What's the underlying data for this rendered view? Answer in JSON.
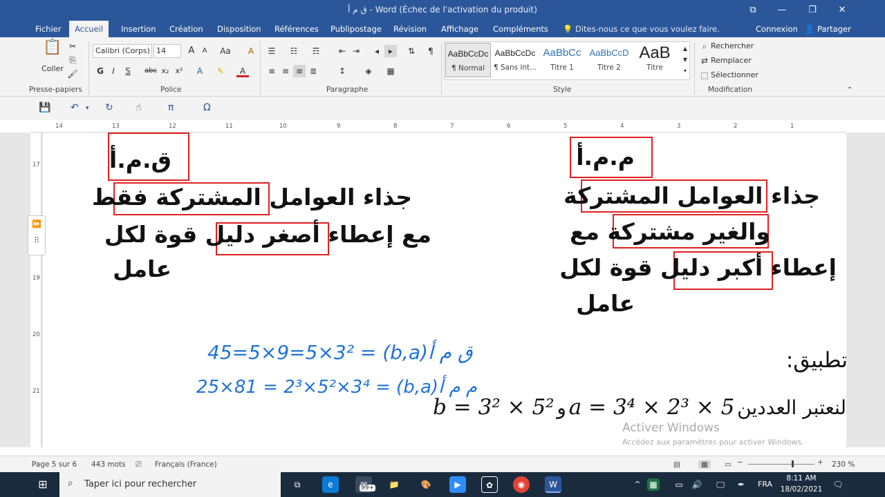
{
  "window": {
    "title": "ق م أ - Word (Échec de l'activation du produit)",
    "controls": [
      "⧉",
      "—",
      "❐",
      "✕"
    ]
  },
  "tabs": [
    "Fichier",
    "Accueil",
    "Insertion",
    "Création",
    "Disposition",
    "Références",
    "Publipostage",
    "Révision",
    "Affichage",
    "Compléments"
  ],
  "tell_me": "Dites-nous ce que vous voulez faire.",
  "account": {
    "signin": "Connexion",
    "share": "Partager"
  },
  "ribbon": {
    "clipboard": {
      "label": "Presse-papiers",
      "paste": "Coller"
    },
    "font": {
      "label": "Police",
      "family": "Calibri (Corps)",
      "size": "14",
      "grow": "A",
      "shrink": "A",
      "case": "Aa",
      "bold": "G",
      "italic": "I",
      "underline": "S",
      "strike": "abc",
      "sub": "x₂",
      "sup": "x²"
    },
    "paragraph": {
      "label": "Paragraphe",
      "pilcrow": "¶"
    },
    "styles": {
      "label": "Style",
      "items": [
        {
          "preview": "AaBbCcDc",
          "name": "¶ Normal"
        },
        {
          "preview": "AaBbCcDc",
          "name": "¶ Sans int..."
        },
        {
          "preview": "AaBbCc",
          "name": "Titre 1"
        },
        {
          "preview": "AaBbCcD",
          "name": "Titre 2"
        },
        {
          "preview": "AaB",
          "name": "Titre"
        }
      ]
    },
    "editing": {
      "label": "Modification",
      "find": "Rechercher",
      "replace": "Remplacer",
      "select": "Sélectionner"
    }
  },
  "qat": {
    "pi": "π",
    "omega": "Ω"
  },
  "ruler": {
    "h": [
      "14",
      "13",
      "12",
      "11",
      "10",
      "9",
      "8",
      "7",
      "6",
      "5",
      "4",
      "3",
      "2",
      "1"
    ],
    "v": [
      "17",
      "18",
      "19",
      "20",
      "21"
    ]
  },
  "document": {
    "right_block": {
      "heading": "م.م.أ",
      "lines": [
        "جذاء العوامل المشتركة",
        "والغير مشتركة مع",
        "إعطاء أكبر دليل قوة لكل",
        "عامل"
      ]
    },
    "left_block": {
      "heading": "ق.م.أ",
      "lines": [
        "جذاء العوامل المشتركة فقط",
        "مع إعطاء أصغر دليل قوة لكل",
        "عامل"
      ]
    },
    "application_label": "تطبيق:",
    "exercise_text": "لنعتبر العددين",
    "exercise_math_a": "a = 3⁴ × 2³ × 5",
    "exercise_and": "و",
    "exercise_math_b": "b = 3² × 5²",
    "handwritten_1": "45=5×9=5×3² = (b,a)ق م أ",
    "handwritten_2": "25×81 = 2³×5²×3⁴ = (b,a)م م أ"
  },
  "watermark": {
    "title": "Activer Windows",
    "subtitle": "Accédez aux paramètres pour activer Windows."
  },
  "status": {
    "page": "Page 5 sur 6",
    "words": "443 mots",
    "language": "Français (France)",
    "zoom": "230 %"
  },
  "taskbar": {
    "search_placeholder": "Taper ici pour rechercher",
    "badge": "99+",
    "lang": "FRA",
    "time": "8:11 AM",
    "date": "18/02/2021"
  }
}
